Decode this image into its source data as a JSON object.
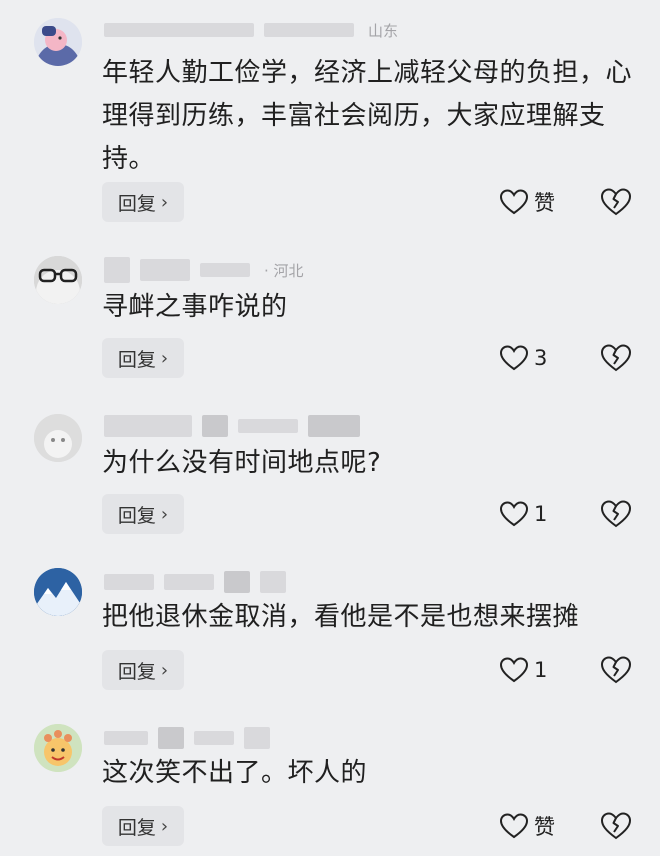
{
  "comments": [
    {
      "location": "山东",
      "content": "年轻人勤工俭学，经济上减轻父母的负担，心理得到历练，丰富社会阅历，大家应理解支持。",
      "reply_label": "回复",
      "like_label": "赞",
      "avatar": "cartoon-avatar"
    },
    {
      "location": "· 河北",
      "content": "寻衅之事咋说的",
      "reply_label": "回复",
      "like_label": "3",
      "avatar": "glasses-avatar"
    },
    {
      "location": "",
      "content": "为什么没有时间地点呢?",
      "reply_label": "回复",
      "like_label": "1",
      "avatar": "gray-avatar"
    },
    {
      "location": "",
      "content": "把他退休金取消，看他是不是也想来摆摊",
      "reply_label": "回复",
      "like_label": "1",
      "avatar": "mountain-avatar"
    },
    {
      "location": "",
      "content": "这次笑不出了。坏人的",
      "reply_label": "回复",
      "like_label": "赞",
      "avatar": "cartoon-face-avatar"
    }
  ],
  "icons": {
    "reply_chevron": "chevron-right-icon",
    "like": "heart-outline-icon",
    "dislike": "broken-heart-icon"
  },
  "colors": {
    "background": "#eeeff1",
    "reply_button": "#e3e4e7",
    "meta_text": "#a4a4a8"
  }
}
